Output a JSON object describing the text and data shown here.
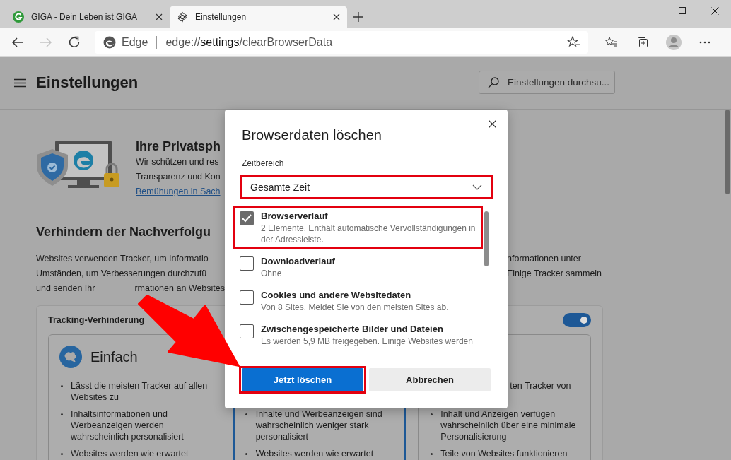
{
  "tabs": [
    {
      "title": "GIGA - Dein Leben ist GIGA",
      "selected": false
    },
    {
      "title": "Einstellungen",
      "selected": true
    }
  ],
  "toolbar": {
    "nav_buttons": [
      {
        "kind": "back",
        "disabled": false
      },
      {
        "kind": "forward",
        "disabled": true
      },
      {
        "kind": "refresh",
        "disabled": false
      }
    ],
    "site_label": "Edge",
    "url": "edge://**settings**/clearBrowserData"
  },
  "settings_header": {
    "title": "Einstellungen",
    "search_placeholder": "Einstellungen durchsu..."
  },
  "privacy": {
    "heading": "Ihre Privatsph",
    "lines": [
      "Wir schützen und res",
      "Transparenz und Kon"
    ],
    "link": "Bemühungen in Sach"
  },
  "tracking": {
    "heading": "Verhindern der Nachverfolgu",
    "paragraph": [
      {
        "left": "Websites verwenden Tracker, um Informatio",
        "right": "nformationen unter"
      },
      {
        "left": "Umständen, um Verbesserungen durchzufü",
        "right": "Einige Tracker sammeln"
      },
      {
        "left": "und senden Ihr",
        "left_after": "rmationen an Websites"
      }
    ],
    "card": {
      "title": "Tracking-Verhinderung",
      "on": true,
      "options": [
        {
          "title": "Einfach",
          "selected": false,
          "bullets": [
            "Lässt die meisten Tracker auf allen Websites zu",
            "Inhaltsinformationen und Werbeanzeigen werden wahrscheinlich personalisiert",
            "Websites werden wie erwartet"
          ]
        },
        {
          "selected": true,
          "bullets": [
            "Inhalte und Werbeanzeigen sind wahrscheinlich weniger stark personalisiert",
            "Websites werden wie erwartet"
          ]
        },
        {
          "selected": false,
          "lead_fragment": "ten Tracker von",
          "bullets": [
            "Inhalt und Anzeigen verfügen wahrscheinlich über eine minimale Personalisierung",
            "Teile von Websites funktionieren"
          ]
        }
      ]
    }
  },
  "dialog": {
    "title": "Browserdaten löschen",
    "range_label": "Zeitbereich",
    "range_value": "Gesamte Zeit",
    "range_highlighted": true,
    "items": [
      {
        "title": "Browserverlauf",
        "description": "2 Elemente. Enthält automatische Vervollständigungen in der Adressleiste.",
        "checked": true,
        "highlighted": true
      },
      {
        "title": "Downloadverlauf",
        "description": "Ohne",
        "checked": false,
        "highlighted": false
      },
      {
        "title": "Cookies und andere Websitedaten",
        "description": "Von 8 Sites. Meldet Sie von den meisten Sites ab.",
        "checked": false,
        "highlighted": false
      },
      {
        "title": "Zwischengespeicherte Bilder und Dateien",
        "description": "Es werden 5,9 MB freigegeben. Einige Websites werden",
        "checked": false,
        "highlighted": false
      }
    ],
    "buttons": [
      {
        "label": "Jetzt löschen",
        "kind": "primary",
        "highlighted": true
      },
      {
        "label": "Abbrechen",
        "kind": "secondary",
        "highlighted": false
      }
    ]
  },
  "annotations": [
    {
      "kind": "arrow"
    }
  ]
}
